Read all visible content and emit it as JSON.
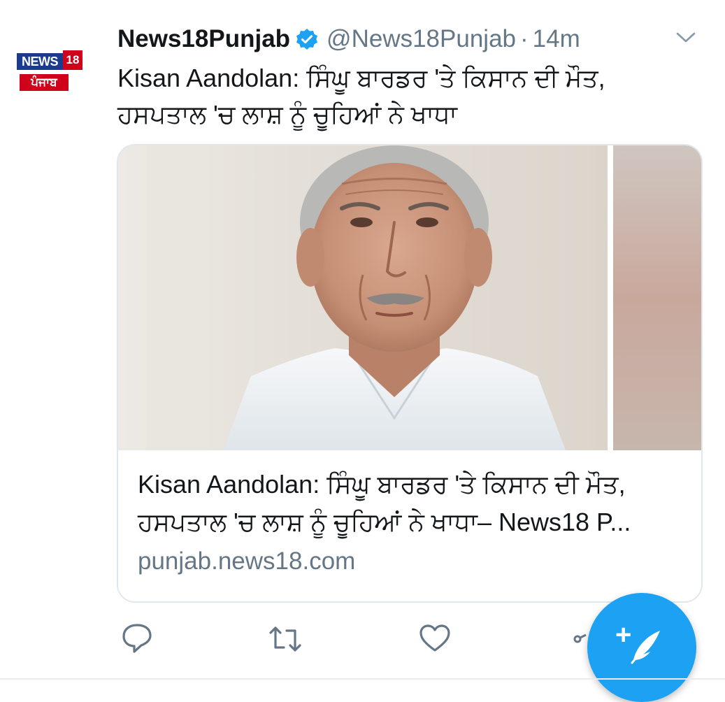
{
  "account": {
    "logo_top": "NEWS",
    "logo_number": "18",
    "logo_bottom": "ਪੰਜਾਬ",
    "display_name": "News18Punjab",
    "handle": "@News18Punjab",
    "separator": "·",
    "timestamp": "14m",
    "verified": true
  },
  "tweet": {
    "text": "Kisan Aandolan: ਸਿੰਘੂ ਬਾਰਡਰ 'ਤੇ ਕਿਸਾਨ ਦੀ ਮੌਤ, ਹਸਪਤਾਲ 'ਚ ਲਾਸ਼ ਨੂੰ ਚੂਹਿਆਂ ਨੇ ਖਾਧਾ"
  },
  "card": {
    "title": "Kisan Aandolan: ਸਿੰਘੂ ਬਾਰਡਰ 'ਤੇ ਕਿਸਾਨ ਦੀ ਮੌਤ, ਹਸਪਤਾਲ 'ਚ ਲਾਸ਼ ਨੂੰ ਚੂਹਿਆਂ ਨੇ ਖਾਧਾ– News18 P...",
    "domain": "punjab.news18.com"
  },
  "actions": {
    "icons": [
      "reply-icon",
      "retweet-icon",
      "like-icon",
      "share-icon"
    ]
  },
  "fab": {
    "icon": "compose-tweet-icon",
    "symbol": "+"
  },
  "colors": {
    "accent": "#1da1f2",
    "secondary_text": "#657786",
    "brand_blue": "#1b3b8c",
    "brand_red": "#d0021b"
  }
}
